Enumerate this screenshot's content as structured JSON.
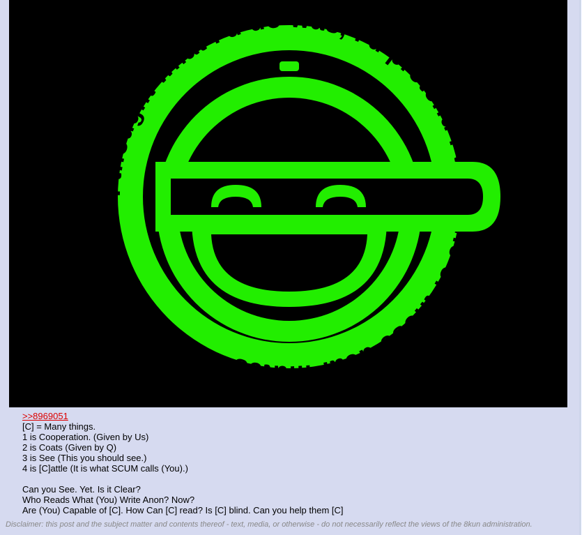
{
  "image": {
    "logo_name": "laughing-man-logo",
    "logo_color": "#22ee00",
    "background_color": "#000000",
    "ring_text": "I thought what I'd do was, I'd pretend I was one of those deaf-mutes "
  },
  "post": {
    "quote_link": ">>8969051",
    "lines": [
      "[C] = Many things.",
      "1 is Cooperation. (Given by Us)",
      "2 is Coats (Given by Q)",
      "3 is See (This you should see.)",
      "4 is [C]attle (It is what SCUM calls (You).)",
      "",
      "Can you See. Yet. Is it Clear?",
      "Who Reads What (You) Write Anon? Now?",
      "Are (You) Capable of [C]. How Can [C] read? Is [C] blind. Can you help them [C]"
    ]
  },
  "footer": {
    "disclaimer": "Disclaimer: this post and the subject matter and contents thereof - text, media, or otherwise - do not necessarily reflect the views of the 8kun administration."
  },
  "colors": {
    "post_background": "#d6daf0",
    "quote_link": "#dd0000",
    "disclaimer_text": "#888888"
  }
}
